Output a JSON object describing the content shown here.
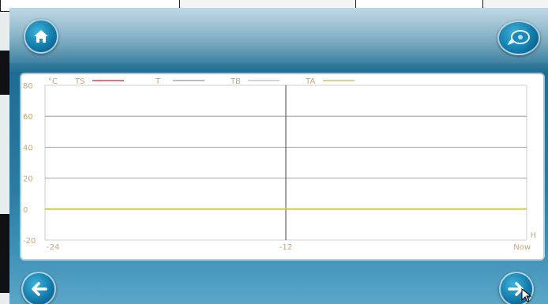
{
  "icons": {
    "home": "home-icon",
    "chat": "chat-bubble-icon",
    "back": "arrow-left-icon",
    "next": "arrow-right-icon"
  },
  "colors": {
    "temp_sensor_line": "#d24a4a",
    "temperature_line": "#a8a8a8",
    "ta_line": "#d7c84a",
    "tick_label": "#c8a878"
  },
  "chart_data": {
    "type": "line",
    "unit_label": "°C",
    "x": [
      -24,
      -12,
      0
    ],
    "xticks": [
      "-24",
      "-12",
      "Now"
    ],
    "xunit": "H",
    "yticks": [
      "80",
      "60",
      "40",
      "20",
      "0",
      "-20"
    ],
    "ylim": [
      -20,
      80
    ],
    "xlim": [
      -24,
      0
    ],
    "grid": true,
    "legend_position": "top",
    "series": [
      {
        "name": "TS",
        "color": "#d24a4a",
        "values": [
          null,
          null,
          null
        ]
      },
      {
        "name": "T",
        "color": "#a8a8a8",
        "values": [
          null,
          null,
          null
        ]
      },
      {
        "name": "TB",
        "color": "#c8c8c8",
        "values": [
          null,
          null,
          null
        ]
      },
      {
        "name": "TA",
        "color": "#d7c84a",
        "values": [
          0,
          0,
          0
        ]
      }
    ]
  }
}
